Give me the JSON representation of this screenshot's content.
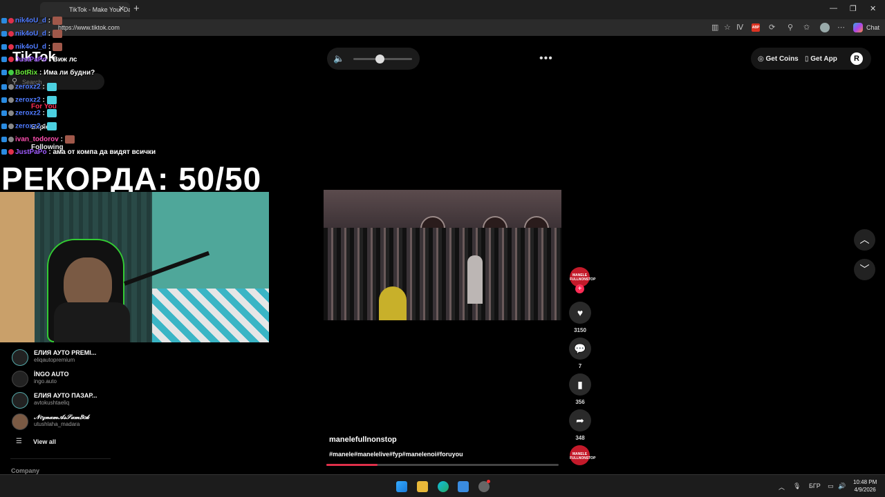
{
  "browser": {
    "tab_title": "TikTok - Make Your Day",
    "url": "https://www.tiktok.com",
    "chat_label": "Chat",
    "abp_label": "ABP"
  },
  "tiktok": {
    "logo": "TikTok",
    "search_placeholder": "Search",
    "nav": [
      "For You",
      "Explore",
      "Following"
    ],
    "get_coins": "Get Coins",
    "get_app": "Get App",
    "volume_level_percent": 45,
    "following_accounts": [
      {
        "name": "ЕЛИЯ АУТО PREMI...",
        "handle": "eliqautopremium"
      },
      {
        "name": "İNGO AUTO",
        "handle": "ingo.auto"
      },
      {
        "name": "ЕЛИЯ АУТО ПАЗАР...",
        "handle": "avtokushtaeliq"
      },
      {
        "name": "𝒩𝑒𝓏𝓃𝒶𝓂𝒜𝓈𝒮𝒶𝓂𝐵𝑜𝓀",
        "handle": "utushlaha_madara"
      }
    ],
    "view_all": "View all",
    "company": "Company",
    "video": {
      "author": "manelefullnonstop",
      "tags": "#manele#manelelive#fyp#manelenoi#foruyou",
      "progress_percent": 22,
      "avatar_text": "MANELE FULLNONSTOP"
    },
    "actions": {
      "likes": "3150",
      "comments": "7",
      "saves": "356",
      "shares": "348"
    }
  },
  "overlay": {
    "record_text": "РЕКОРДА: 50/50",
    "chat": [
      {
        "user": "nik4oU_d",
        "color": "#4f7bff",
        "msg": "",
        "emote": "brown"
      },
      {
        "user": "nik4oU_d",
        "color": "#4f7bff",
        "msg": "",
        "emote": "brown"
      },
      {
        "user": "nik4oU_d",
        "color": "#4f7bff",
        "msg": "",
        "emote": "brown"
      },
      {
        "user": "JustPaPo",
        "color": "#a05cff",
        "msg": "Виж лс",
        "emote": ""
      },
      {
        "user": "BotRix",
        "color": "#6cf03c",
        "msg": "Има ли будни?",
        "emote": ""
      },
      {
        "user": "zeroxz2",
        "color": "#4f7bff",
        "msg": "",
        "emote": "cyan"
      },
      {
        "user": "zeroxz2",
        "color": "#4f7bff",
        "msg": "",
        "emote": "cyan"
      },
      {
        "user": "zeroxz2",
        "color": "#4f7bff",
        "msg": "",
        "emote": "cyan"
      },
      {
        "user": "zeroxz2",
        "color": "#4f7bff",
        "msg": "",
        "emote": "cyan"
      },
      {
        "user": "ivan_todorov",
        "color": "#ff4fb0",
        "msg": "",
        "emote": "brown"
      },
      {
        "user": "JustPaPo",
        "color": "#a05cff",
        "msg": "ама от компа да видят всички",
        "emote": ""
      }
    ]
  },
  "taskbar": {
    "lang": "БГР",
    "time": "10:48 PM",
    "date": "4/9/2026"
  }
}
